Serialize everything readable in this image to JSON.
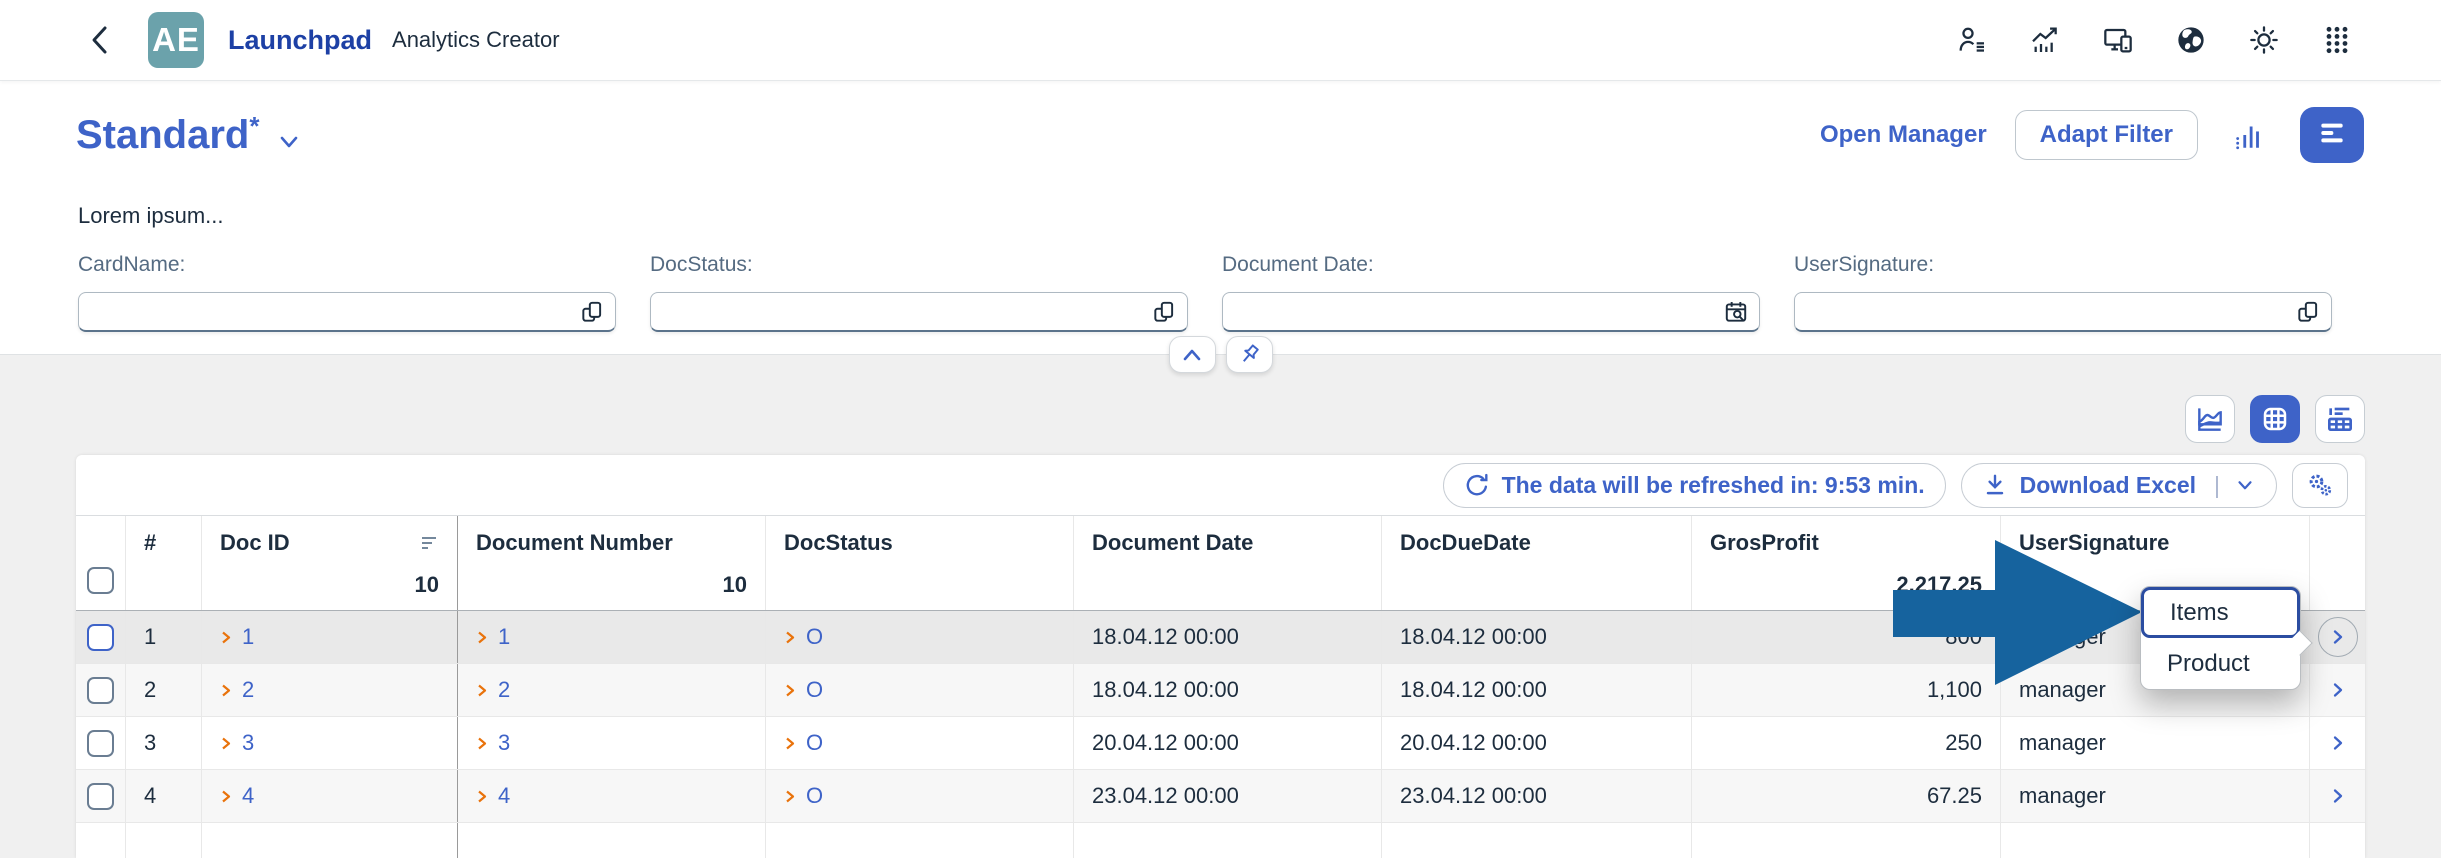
{
  "header": {
    "app_initials": "AE",
    "title": "Launchpad",
    "subtitle": "Analytics Creator",
    "icons": [
      "user-settings-icon",
      "trend-chart-icon",
      "devices-icon",
      "globe-icon",
      "brightness-icon",
      "app-grid-icon"
    ]
  },
  "variant_bar": {
    "title": "Standard",
    "modified_marker": "*",
    "open_manager_label": "Open Manager",
    "adapt_filter_label": "Adapt Filter"
  },
  "description": "Lorem ipsum...",
  "filters": [
    {
      "label": "CardName:",
      "value": "",
      "icon": "value-help-icon"
    },
    {
      "label": "DocStatus:",
      "value": "",
      "icon": "value-help-icon"
    },
    {
      "label": "Document Date:",
      "value": "",
      "icon": "date-picker-icon"
    },
    {
      "label": "UserSignature:",
      "value": "",
      "icon": "value-help-icon"
    }
  ],
  "toolbar": {
    "refresh_text": "The data will be refreshed in: 9:53 min.",
    "download_label": "Download Excel",
    "download_divider": "|"
  },
  "table": {
    "columns": [
      "#",
      "Doc ID",
      "Document Number",
      "DocStatus",
      "Document Date",
      "DocDueDate",
      "GrosProfit",
      "UserSignature"
    ],
    "totals": {
      "doc_id": "10",
      "document_number": "10",
      "gros_profit": "2,217.25"
    },
    "rows": [
      {
        "num": "1",
        "doc_id": "1",
        "document_number": "1",
        "doc_status": "O",
        "document_date": "18.04.12 00:00",
        "doc_due_date": "18.04.12 00:00",
        "gros_profit": "800",
        "user_signature": "manager"
      },
      {
        "num": "2",
        "doc_id": "2",
        "document_number": "2",
        "doc_status": "O",
        "document_date": "18.04.12 00:00",
        "doc_due_date": "18.04.12 00:00",
        "gros_profit": "1,100",
        "user_signature": "manager"
      },
      {
        "num": "3",
        "doc_id": "3",
        "document_number": "3",
        "doc_status": "O",
        "document_date": "20.04.12 00:00",
        "doc_due_date": "20.04.12 00:00",
        "gros_profit": "250",
        "user_signature": "manager"
      },
      {
        "num": "4",
        "doc_id": "4",
        "document_number": "4",
        "doc_status": "O",
        "document_date": "23.04.12 00:00",
        "doc_due_date": "23.04.12 00:00",
        "gros_profit": "67.25",
        "user_signature": "manager"
      }
    ]
  },
  "context_menu": {
    "items": [
      {
        "label": "Items",
        "focused": true
      },
      {
        "label": "Product",
        "focused": false
      }
    ]
  },
  "colors": {
    "accent_blue": "#3E63C8",
    "brand_blue": "#1D40A5",
    "logo_teal": "#6BA2AB",
    "pointer_arrow_blue": "#16639E",
    "cell_chevron_orange": "#E9730C",
    "text_navy": "#1D2D3E",
    "label_gray_blue": "#556B82",
    "page_background": "#F0F0F0"
  }
}
